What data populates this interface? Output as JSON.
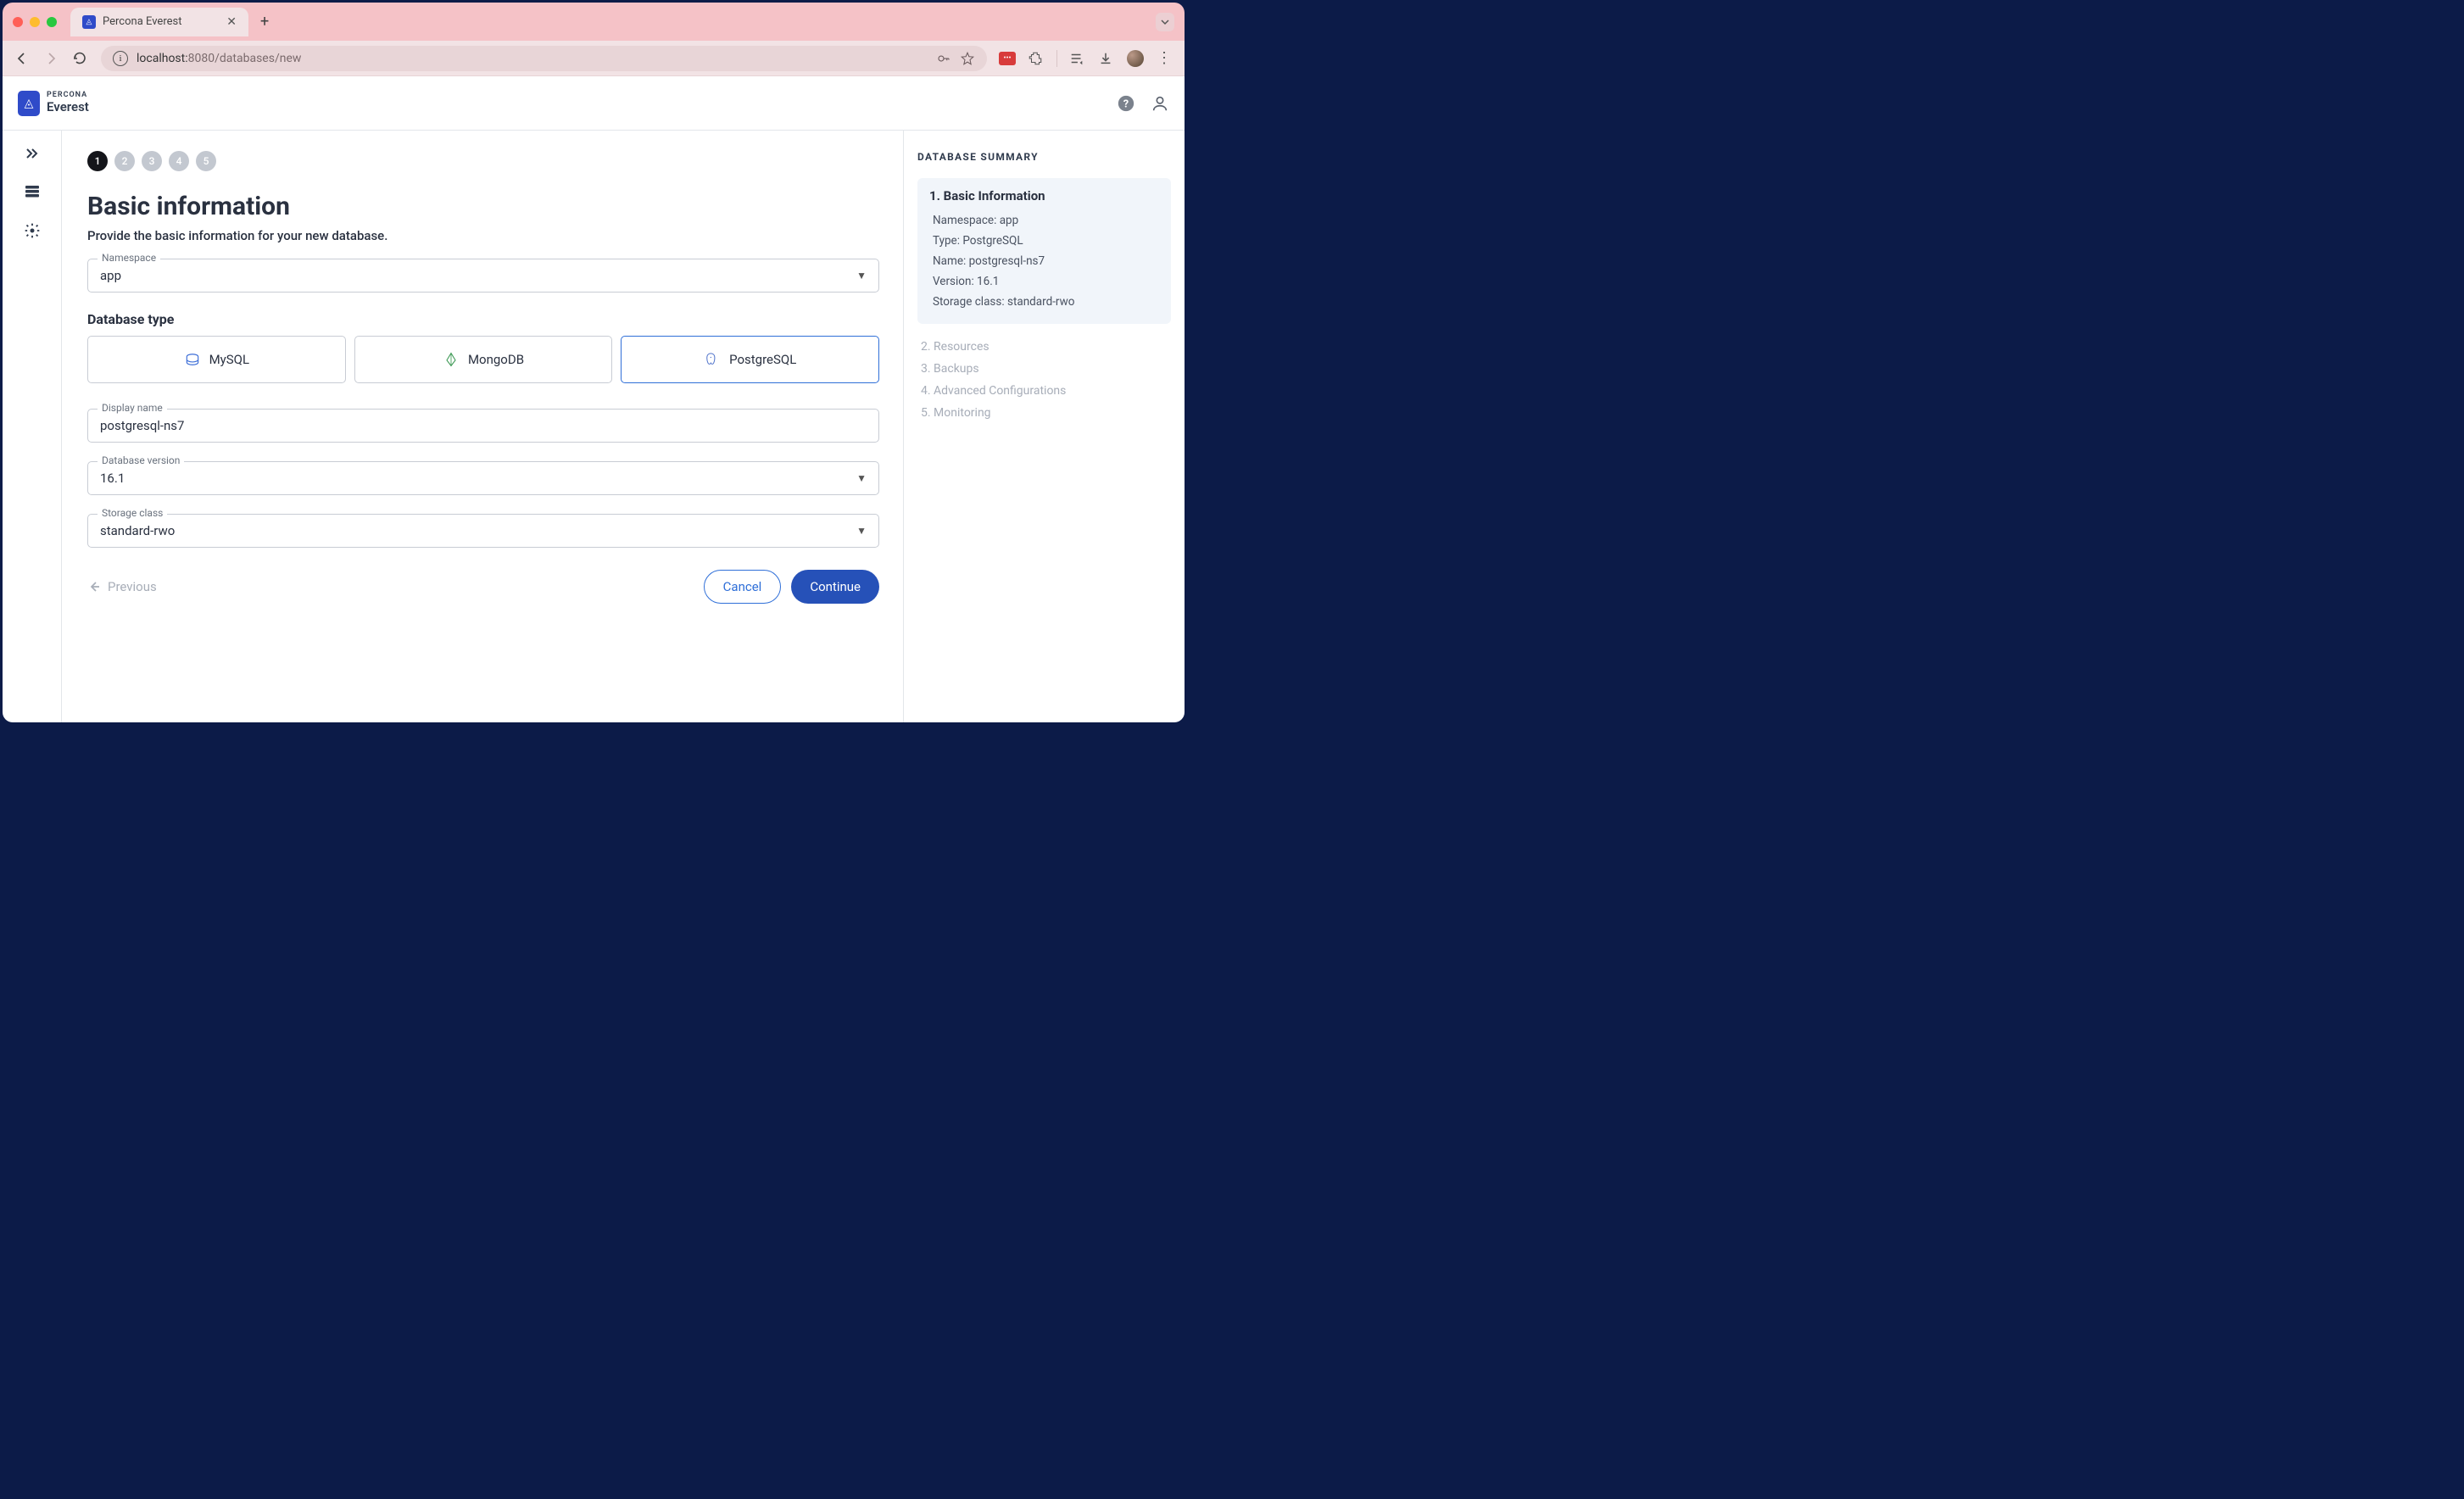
{
  "browser": {
    "tab_title": "Percona Everest",
    "url_host": "localhost:",
    "url_rest": "8080/databases/new"
  },
  "header": {
    "brand_sup": "PERCONA",
    "brand_name": "Everest"
  },
  "stepper": {
    "steps": [
      "1",
      "2",
      "3",
      "4",
      "5"
    ],
    "active": 0
  },
  "page": {
    "title": "Basic information",
    "subtitle": "Provide the basic information for your new database."
  },
  "fields": {
    "namespace_label": "Namespace",
    "namespace_value": "app",
    "dbtype_label": "Database type",
    "dbtypes": {
      "mysql": "MySQL",
      "mongodb": "MongoDB",
      "postgres": "PostgreSQL"
    },
    "display_name_label": "Display name",
    "display_name_value": "postgresql-ns7",
    "version_label": "Database version",
    "version_value": "16.1",
    "storage_label": "Storage class",
    "storage_value": "standard-rwo"
  },
  "actions": {
    "previous": "Previous",
    "cancel": "Cancel",
    "continue": "Continue"
  },
  "summary": {
    "title": "DATABASE SUMMARY",
    "block_heading": "1. Basic Information",
    "lines": {
      "ns": "Namespace: app",
      "type": "Type: PostgreSQL",
      "name": "Name: postgresql-ns7",
      "ver": "Version: 16.1",
      "storage": "Storage class: standard-rwo"
    },
    "steps": {
      "s2": "2. Resources",
      "s3": "3. Backups",
      "s4": "4. Advanced Configurations",
      "s5": "5. Monitoring"
    }
  }
}
